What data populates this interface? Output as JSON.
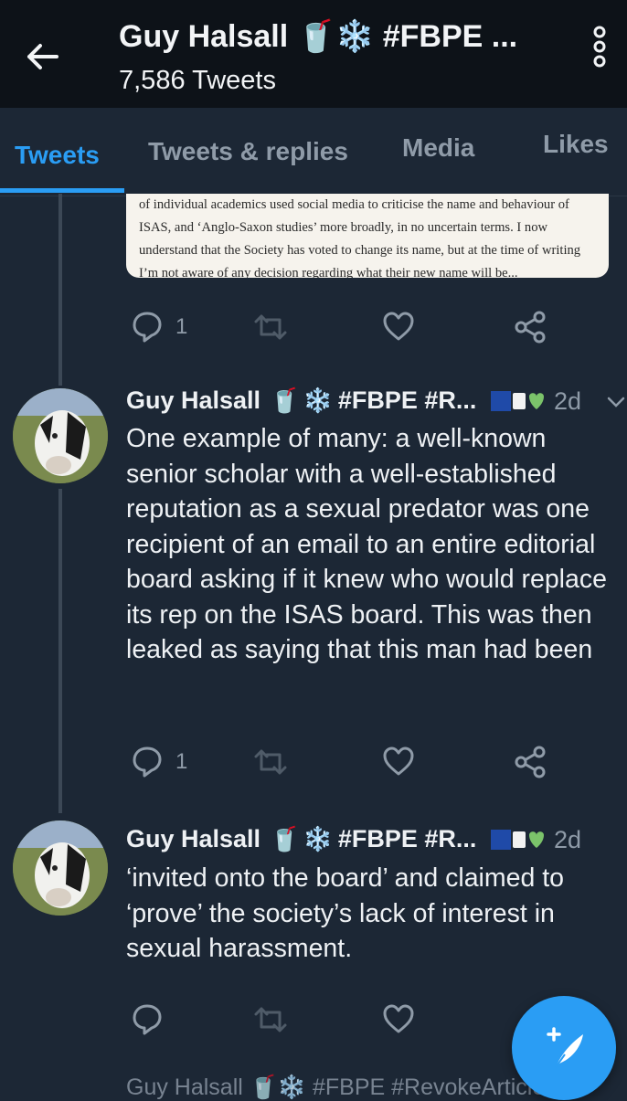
{
  "header": {
    "title": "Guy Halsall 🥤❄️ #FBPE ...",
    "subtitle": "7,586 Tweets"
  },
  "tabs": [
    {
      "label": "Tweets"
    },
    {
      "label": "Tweets & replies"
    },
    {
      "label": "Media"
    },
    {
      "label": "Likes"
    }
  ],
  "snippet": {
    "lines": [
      "of individual academics used social media to criticise the name and behaviour of",
      "ISAS, and ‘Anglo-Saxon studies’ more broadly, in no uncertain terms. I now",
      "understand that the Society has voted to change its name, but at the time of writing",
      "I’m not aware of any decision regarding what their new name will be..."
    ]
  },
  "tweets": [
    {
      "actions": {
        "reply_count": "1"
      }
    },
    {
      "name": "Guy Halsall",
      "handle": "#FBPE #R...",
      "time": "2d",
      "text": "One example of many: a well-known senior scholar with a well-established reputation as a sexual predator was one recipient of an email to an entire editorial board asking if it knew who would replace its rep on the ISAS board. This was then leaked as saying that this man had been",
      "actions": {
        "reply_count": "1"
      }
    },
    {
      "name": "Guy Halsall",
      "handle": "#FBPE #R...",
      "time": "2d",
      "text": "‘invited onto the board’ and claimed to ‘prove’ the society’s lack of interest in sexual harassment.",
      "actions": {
        "reply_count": ""
      }
    }
  ],
  "bottom_peek": "Guy Halsall 🥤❄️ #FBPE #RevokeArticle",
  "colors": {
    "accent": "#2a9df4",
    "background": "#1c2735",
    "header": "#0d1218",
    "muted": "#8f9ba8"
  },
  "icons": [
    "back-arrow-icon",
    "more-icon",
    "reply-icon",
    "retweet-icon",
    "like-icon",
    "share-icon",
    "compose-icon"
  ]
}
